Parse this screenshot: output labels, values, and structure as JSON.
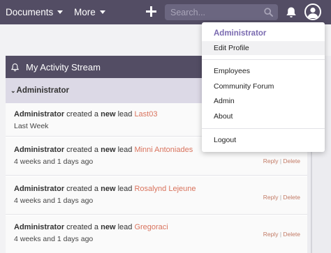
{
  "nav": {
    "documents_label": "Documents",
    "more_label": "More",
    "search_placeholder": "Search..."
  },
  "dashlet": {
    "title": "My Activity Stream",
    "group_label": "Administrator",
    "items": [
      {
        "actor": "Administrator",
        "text": " created a ",
        "emphasis": "new",
        "text2": " lead ",
        "lead": "Last03",
        "time": "Last Week",
        "reply": "",
        "delete": ""
      },
      {
        "actor": "Administrator",
        "text": " created a ",
        "emphasis": "new",
        "text2": " lead ",
        "lead": "Minni Antoniades",
        "time": "4 weeks and 1 days ago",
        "reply": "Reply",
        "delete": "Delete"
      },
      {
        "actor": "Administrator",
        "text": " created a ",
        "emphasis": "new",
        "text2": " lead ",
        "lead": "Rosalynd Lejeune",
        "time": "4 weeks and 1 days ago",
        "reply": "Reply",
        "delete": "Delete"
      },
      {
        "actor": "Administrator",
        "text": " created a ",
        "emphasis": "new",
        "text2": " lead ",
        "lead": "Gregoraci",
        "time": "4 weeks and 1 days ago",
        "reply": "Reply",
        "delete": "Delete"
      }
    ],
    "separator": "|"
  },
  "user_menu": {
    "title": "Administrator",
    "items": [
      "Edit Profile",
      "Employees",
      "Community Forum",
      "Admin",
      "About",
      "Logout"
    ]
  },
  "colors": {
    "topbar": "#534d64",
    "accent_purple": "#7a6ab0",
    "lead_link": "#d9735d",
    "subheader": "#dcd9e6"
  }
}
